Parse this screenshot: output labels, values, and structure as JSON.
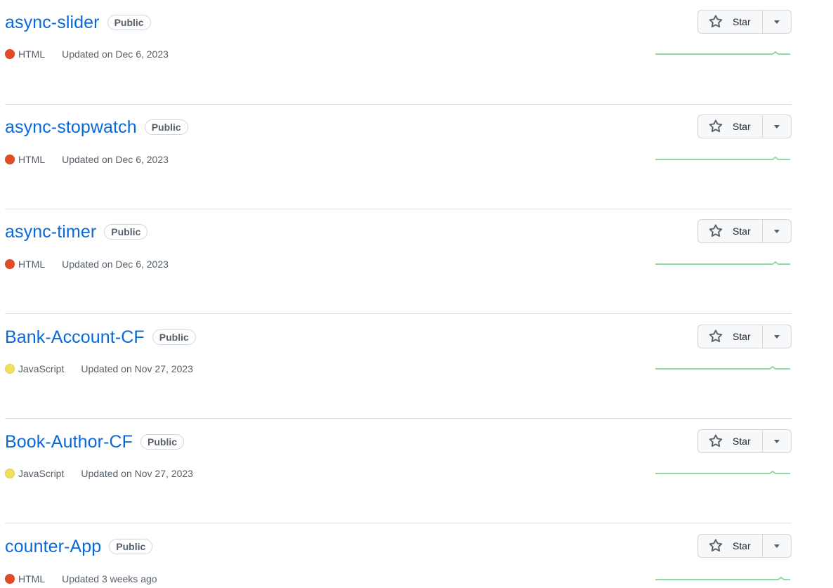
{
  "star_label": "Star",
  "colors": {
    "link": "#0969da",
    "html": "#e34c26",
    "javascript": "#f1e05a",
    "sparkline": "#40c463"
  },
  "repos": [
    {
      "name": "async-slider",
      "visibility": "Public",
      "language": "HTML",
      "language_color": "#e34c26",
      "updated": "Updated on Dec 6, 2023"
    },
    {
      "name": "async-stopwatch",
      "visibility": "Public",
      "language": "HTML",
      "language_color": "#e34c26",
      "updated": "Updated on Dec 6, 2023"
    },
    {
      "name": "async-timer",
      "visibility": "Public",
      "language": "HTML",
      "language_color": "#e34c26",
      "updated": "Updated on Dec 6, 2023"
    },
    {
      "name": "Bank-Account-CF",
      "visibility": "Public",
      "language": "JavaScript",
      "language_color": "#f1e05a",
      "updated": "Updated on Nov 27, 2023"
    },
    {
      "name": "Book-Author-CF",
      "visibility": "Public",
      "language": "JavaScript",
      "language_color": "#f1e05a",
      "updated": "Updated on Nov 27, 2023"
    },
    {
      "name": "counter-App",
      "visibility": "Public",
      "language": "HTML",
      "language_color": "#e34c26",
      "updated": "Updated 3 weeks ago"
    }
  ]
}
